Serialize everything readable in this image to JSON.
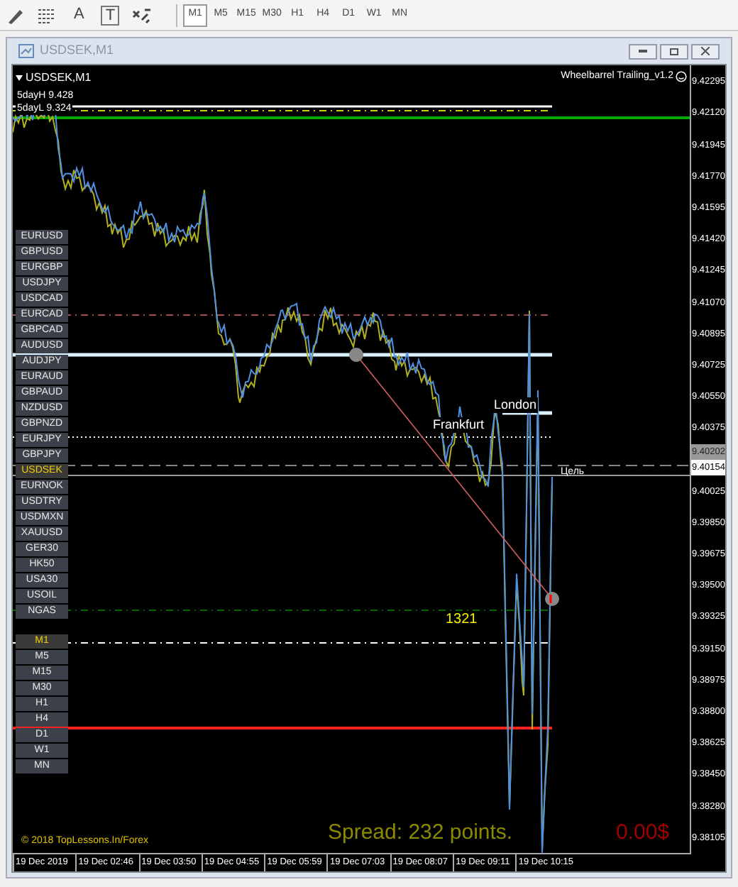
{
  "toolbar": {
    "tools": [
      {
        "kind": "pen"
      },
      {
        "kind": "lines"
      },
      {
        "kind": "text",
        "label": "A"
      },
      {
        "kind": "textbox",
        "label": "T"
      },
      {
        "kind": "arrows"
      }
    ],
    "periods": [
      {
        "label": "M1",
        "selected": true
      },
      {
        "label": "M5",
        "selected": false
      },
      {
        "label": "M15",
        "selected": false
      },
      {
        "label": "M30",
        "selected": false
      },
      {
        "label": "H1",
        "selected": false
      },
      {
        "label": "H4",
        "selected": false
      },
      {
        "label": "D1",
        "selected": false
      },
      {
        "label": "W1",
        "selected": false
      },
      {
        "label": "MN",
        "selected": false
      }
    ]
  },
  "window": {
    "title": "USDSEK,M1"
  },
  "chart": {
    "symbol_label": "USDSEK,M1",
    "indicator": "Wheelbarrel Trailing_v1.2",
    "levels": [
      "5dayH 9.428",
      "5dayL 9.324"
    ],
    "symbols": [
      {
        "label": "EURUSD",
        "selected": false
      },
      {
        "label": "GBPUSD",
        "selected": false
      },
      {
        "label": "EURGBP",
        "selected": false
      },
      {
        "label": "USDJPY",
        "selected": false
      },
      {
        "label": "USDCAD",
        "selected": false
      },
      {
        "label": "EURCAD",
        "selected": false
      },
      {
        "label": "GBPCAD",
        "selected": false
      },
      {
        "label": "AUDUSD",
        "selected": false
      },
      {
        "label": "AUDJPY",
        "selected": false
      },
      {
        "label": "EURAUD",
        "selected": false
      },
      {
        "label": "GBPAUD",
        "selected": false
      },
      {
        "label": "NZDUSD",
        "selected": false
      },
      {
        "label": "GBPNZD",
        "selected": false
      },
      {
        "label": "EURJPY",
        "selected": false
      },
      {
        "label": "GBPJPY",
        "selected": false
      },
      {
        "label": "USDSEK",
        "selected": true
      },
      {
        "label": "EURNOK",
        "selected": false
      },
      {
        "label": "USDTRY",
        "selected": false
      },
      {
        "label": "USDMXN",
        "selected": false
      },
      {
        "label": "XAUUSD",
        "selected": false
      },
      {
        "label": "GER30",
        "selected": false
      },
      {
        "label": "HK50",
        "selected": false
      },
      {
        "label": "USA30",
        "selected": false
      },
      {
        "label": "USOIL",
        "selected": false
      },
      {
        "label": "NGAS",
        "selected": false
      }
    ],
    "timeframes": [
      {
        "label": "M1",
        "selected": true
      },
      {
        "label": "M5",
        "selected": false
      },
      {
        "label": "M15",
        "selected": false
      },
      {
        "label": "M30",
        "selected": false
      },
      {
        "label": "H1",
        "selected": false
      },
      {
        "label": "H4",
        "selected": false
      },
      {
        "label": "D1",
        "selected": false
      },
      {
        "label": "W1",
        "selected": false
      },
      {
        "label": "MN",
        "selected": false
      }
    ],
    "sessions": [
      "Frankfurt",
      "London"
    ],
    "count": "1321",
    "target": "Цель",
    "copyright": "© 2018 TopLessons.In/Forex",
    "spread": "Spread: 232 points.",
    "profit": "0.00$",
    "price_axis": [
      {
        "label": "9.42295",
        "kind": "tick"
      },
      {
        "label": "9.42120",
        "kind": "tick"
      },
      {
        "label": "9.41945",
        "kind": "tick"
      },
      {
        "label": "9.41770",
        "kind": "tick"
      },
      {
        "label": "9.41595",
        "kind": "tick"
      },
      {
        "label": "9.41420",
        "kind": "tick"
      },
      {
        "label": "9.41245",
        "kind": "tick"
      },
      {
        "label": "9.41070",
        "kind": "tick"
      },
      {
        "label": "9.40895",
        "kind": "tick"
      },
      {
        "label": "9.40725",
        "kind": "tick"
      },
      {
        "label": "9.40550",
        "kind": "tick"
      },
      {
        "label": "9.40375",
        "kind": "tick"
      },
      {
        "label": "9.40202",
        "kind": "ask"
      },
      {
        "label": "9.40154",
        "kind": "bid"
      },
      {
        "label": "9.40025",
        "kind": "tick"
      },
      {
        "label": "9.39850",
        "kind": "tick"
      },
      {
        "label": "9.39675",
        "kind": "tick"
      },
      {
        "label": "9.39500",
        "kind": "tick"
      },
      {
        "label": "9.39325",
        "kind": "tick"
      },
      {
        "label": "9.39150",
        "kind": "tick"
      },
      {
        "label": "9.38975",
        "kind": "tick"
      },
      {
        "label": "9.38800",
        "kind": "tick"
      },
      {
        "label": "9.38625",
        "kind": "tick"
      },
      {
        "label": "9.38450",
        "kind": "tick"
      },
      {
        "label": "9.38280",
        "kind": "tick"
      },
      {
        "label": "9.38105",
        "kind": "tick"
      }
    ],
    "time_axis": [
      "19 Dec 2019",
      "19 Dec 02:46",
      "19 Dec 03:50",
      "19 Dec 04:55",
      "19 Dec 05:59",
      "19 Dec 07:03",
      "19 Dec 08:07",
      "19 Dec 09:11",
      "19 Dec 10:15"
    ]
  }
}
